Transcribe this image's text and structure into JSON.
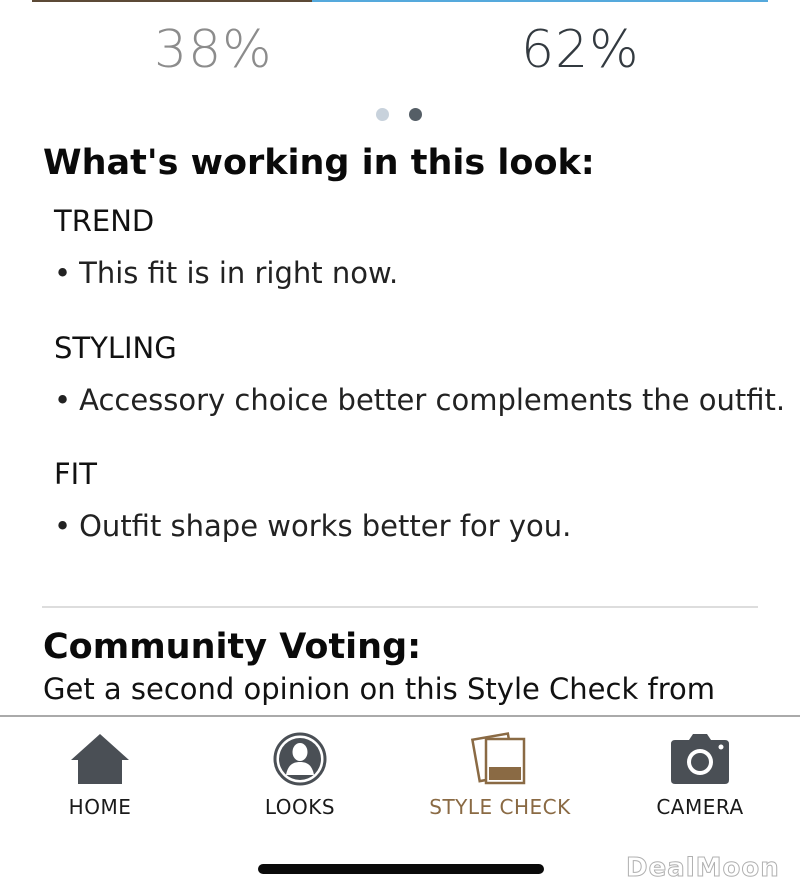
{
  "vote": {
    "left_percent_label": "38%",
    "right_percent_label": "62%",
    "left_fraction": 0.38,
    "right_fraction": 0.62,
    "left_color": "#5c4a36",
    "right_color": "#55a9dc"
  },
  "pager": {
    "pages": 2,
    "active_index": 1
  },
  "working": {
    "title": "What's working in this look:",
    "categories": [
      {
        "name": "TREND",
        "bullet": "This fit is in right now."
      },
      {
        "name": "STYLING",
        "bullet": "Accessory choice better complements the outfit."
      },
      {
        "name": "FIT",
        "bullet": "Outfit shape works better for you."
      }
    ],
    "bullet_symbol": "•"
  },
  "community": {
    "title": "Community Voting:",
    "subtitle": "Get a second opinion on this Style Check from"
  },
  "tabs": [
    {
      "label": "HOME",
      "icon": "home-icon"
    },
    {
      "label": "LOOKS",
      "icon": "person-icon"
    },
    {
      "label": "STYLE CHECK",
      "icon": "photos-icon",
      "active": true
    },
    {
      "label": "CAMERA",
      "icon": "camera-icon"
    }
  ],
  "colors": {
    "active_tab": "#8a6a44"
  },
  "watermark": "DealMoon"
}
